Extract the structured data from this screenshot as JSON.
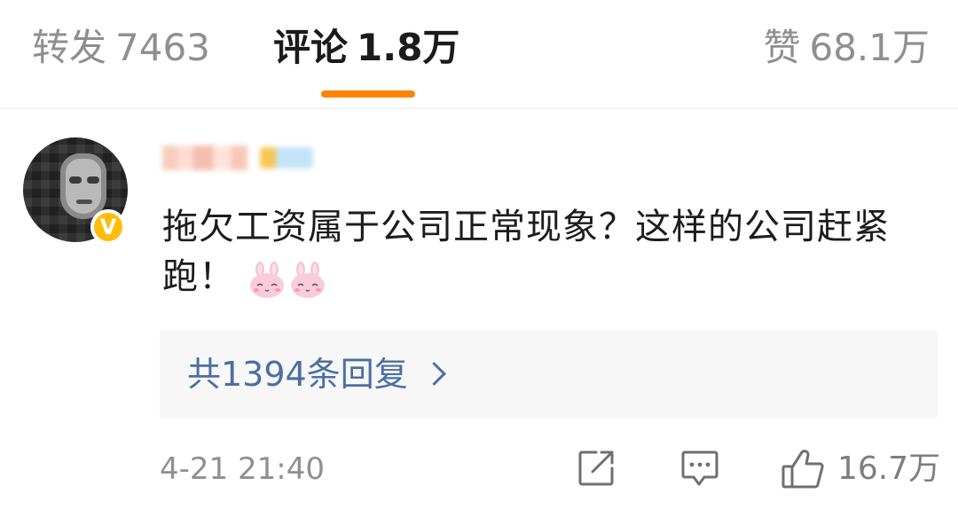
{
  "tabs": {
    "repost": {
      "label": "转发",
      "count": "7463"
    },
    "comments": {
      "label": "评论",
      "count": "1.8万"
    },
    "likes": {
      "label": "赞",
      "count": "68.1万"
    }
  },
  "colors": {
    "active_tab_underline": "#ff8200",
    "link_blue": "#4b6fa3",
    "verified_badge": "#ffbd09"
  },
  "comment": {
    "verified_badge_label": "V",
    "text": "拖欠工资属于公司正常现象？这样的公司赶紧跑！",
    "emojis": [
      "rabbit-emoji",
      "rabbit-emoji"
    ],
    "replies_label": "共1394条回复",
    "timestamp": "4-21 21:40",
    "like_count": "16.7万"
  },
  "icons": {
    "share": "share-icon",
    "comment": "comment-icon",
    "like": "thumbs-up-icon",
    "chevron": "chevron-right-icon"
  }
}
